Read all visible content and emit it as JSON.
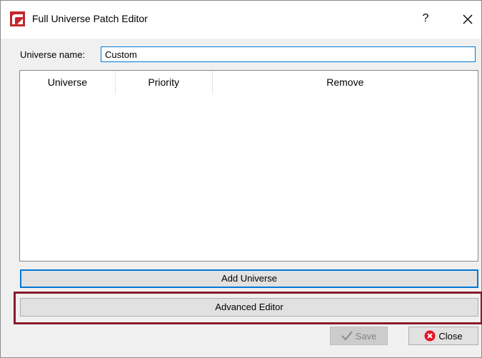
{
  "window": {
    "title": "Full Universe Patch Editor",
    "help_label": "?",
    "app_icon": "app-logo-icon",
    "help_icon": "question-mark-icon",
    "close_icon": "close-x-icon"
  },
  "form": {
    "universe_name_label": "Universe name:",
    "universe_name_value": "Custom"
  },
  "table": {
    "columns": [
      "Universe",
      "Priority",
      "Remove"
    ],
    "rows": []
  },
  "buttons": {
    "add_universe": "Add Universe",
    "advanced_editor": "Advanced Editor",
    "save": "Save",
    "close": "Close"
  },
  "colors": {
    "accent": "#0078d7",
    "highlight": "#8b1a2b",
    "close_icon_red": "#e81123",
    "app_icon_red": "#c4262e"
  }
}
